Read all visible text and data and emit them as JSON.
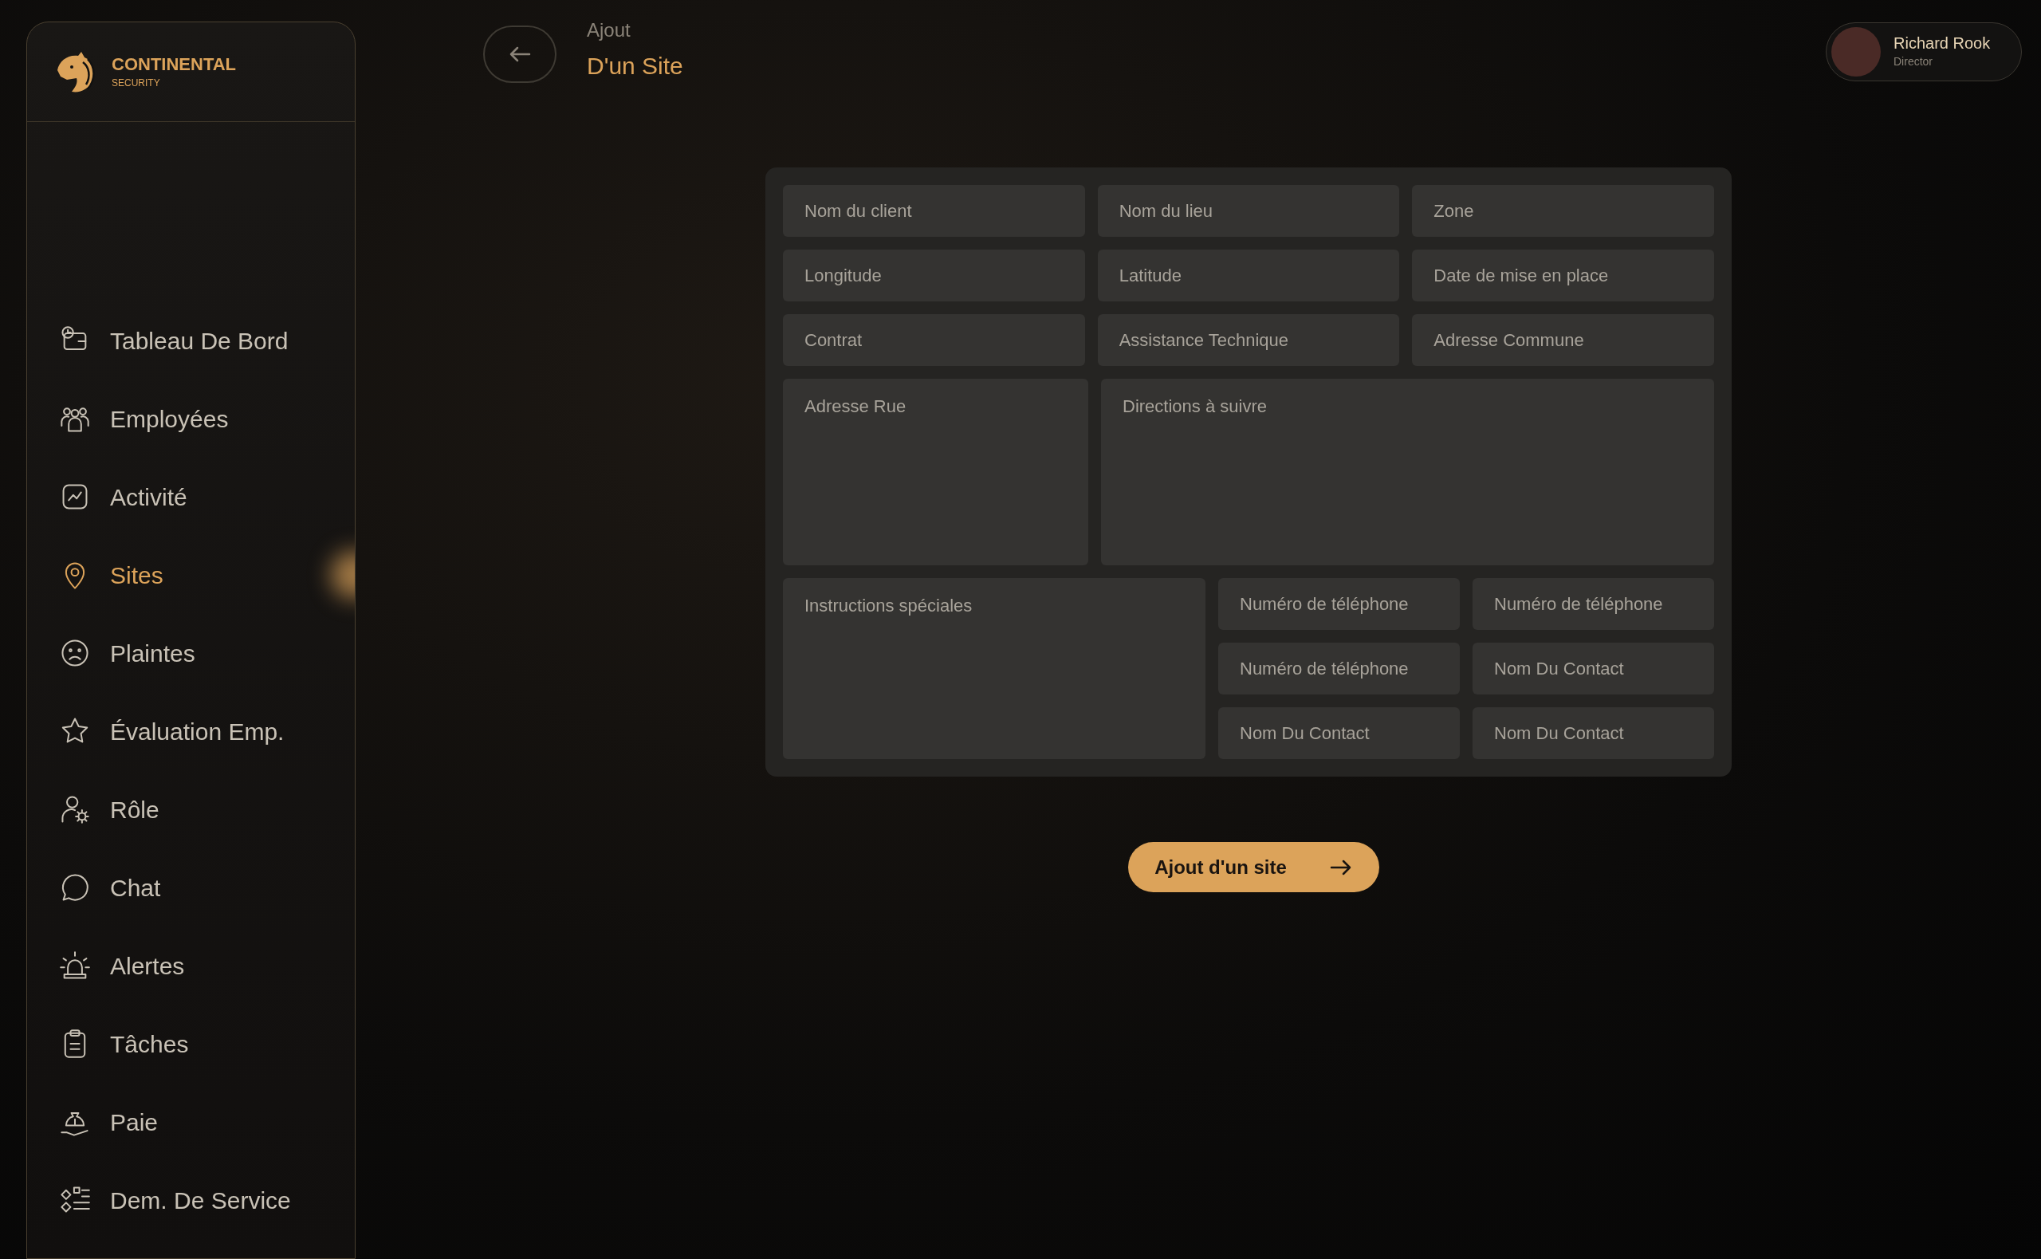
{
  "brand": {
    "name": "CONTINENTAL",
    "tagline": "SECURITY"
  },
  "sidebar": {
    "items": [
      {
        "label": "Tableau De Bord",
        "kind": "dashboard",
        "selected": false
      },
      {
        "label": "Employées",
        "kind": "people",
        "selected": false
      },
      {
        "label": "Activité",
        "kind": "activity",
        "selected": false
      },
      {
        "label": "Sites",
        "kind": "pin",
        "selected": true
      },
      {
        "label": "Plaintes",
        "kind": "sad",
        "selected": false
      },
      {
        "label": "Évaluation Emp.",
        "kind": "star",
        "selected": false
      },
      {
        "label": "Rôle",
        "kind": "role",
        "selected": false
      },
      {
        "label": "Chat",
        "kind": "chat",
        "selected": false
      },
      {
        "label": "Alertes",
        "kind": "alarm",
        "selected": false
      },
      {
        "label": "Tâches",
        "kind": "clipboard",
        "selected": false
      },
      {
        "label": "Paie",
        "kind": "money",
        "selected": false
      },
      {
        "label": "Dem. De Service",
        "kind": "list",
        "selected": false
      }
    ]
  },
  "header": {
    "title": "Ajout",
    "subtitle": "D'un Site"
  },
  "user": {
    "name": "Richard Rook",
    "role": "Director"
  },
  "form": {
    "fields": [
      {
        "placeholder": "Nom du client"
      },
      {
        "placeholder": "Nom du lieu"
      },
      {
        "placeholder": "Zone"
      },
      {
        "placeholder": "Longitude"
      },
      {
        "placeholder": "Latitude"
      },
      {
        "placeholder": "Date de mise en place"
      },
      {
        "placeholder": "Contrat"
      },
      {
        "placeholder": "Assistance Technique"
      },
      {
        "placeholder": "Adresse Commune"
      }
    ],
    "address_fields": [
      {
        "placeholder": "Adresse Rue"
      },
      {
        "placeholder": "Directions à suivre"
      }
    ],
    "notes": {
      "placeholder": "Instructions spéciales"
    },
    "contact_fields": [
      {
        "placeholder": "Numéro de téléphone"
      },
      {
        "placeholder": "Numéro de téléphone"
      },
      {
        "placeholder": "Numéro de téléphone"
      },
      {
        "placeholder": "Nom Du Contact"
      },
      {
        "placeholder": "Nom Du Contact"
      },
      {
        "placeholder": "Nom Du Contact"
      }
    ]
  },
  "submit": {
    "label": "Ajout d'un site"
  }
}
